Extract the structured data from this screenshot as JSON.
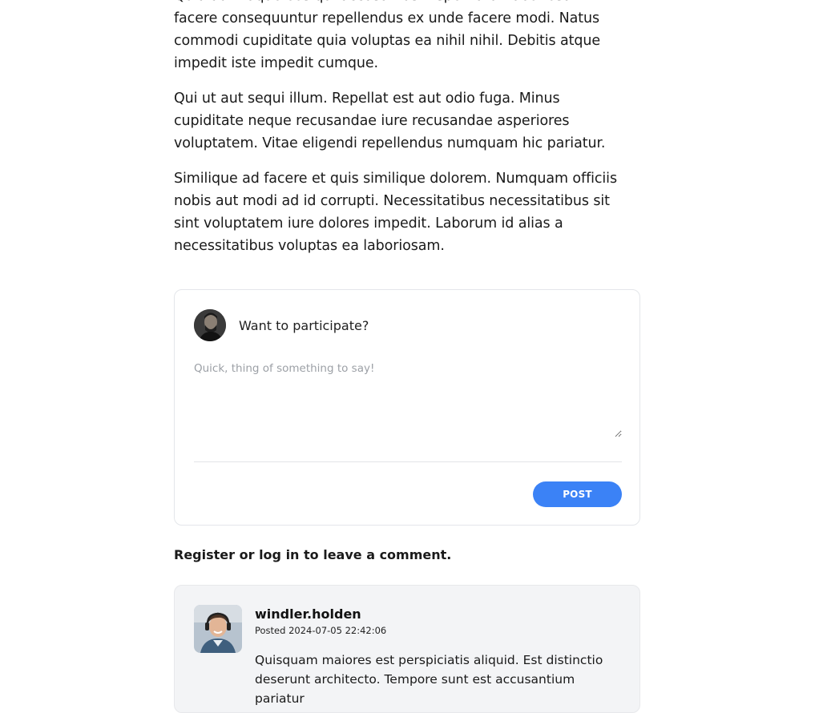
{
  "article": {
    "paragraphs": [
      "Quia aut itaque eos qui accusamus. Aspernatur laboriosam facere consequuntur repellendus ex unde facere modi. Natus commodi cupiditate quia voluptas ea nihil nihil. Debitis atque impedit iste impedit cumque.",
      "Qui ut aut sequi illum. Repellat est aut odio fuga. Minus cupiditate neque recusandae iure recusandae asperiores voluptatem. Vitae eligendi repellendus numquam hic pariatur.",
      "Similique ad facere et quis similique dolorem. Numquam officiis nobis aut modi ad id corrupti. Necessitatibus necessitatibus sit sint voluptatem iure dolores impedit. Laborum id alias a necessitatibus voluptas ea laboriosam."
    ]
  },
  "compose": {
    "title": "Want to participate?",
    "placeholder": "Quick, thing of something to say!",
    "post_label": "POST"
  },
  "auth_prompt": {
    "register": "Register",
    "or": " or ",
    "login": "log in",
    "suffix": " to leave a comment."
  },
  "comments": [
    {
      "author": "windler.holden",
      "posted": "Posted 2024-07-05 22:42:06",
      "body": "Quisquam maiores est perspiciatis aliquid. Est distinctio deserunt architecto. Tempore sunt est accusantium pariatur"
    }
  ],
  "colors": {
    "accent": "#3b82f6",
    "comment_bg": "#f3f4f6",
    "border": "#e4e6ea"
  },
  "icons": {
    "compose_avatar": "user-avatar-icon",
    "comment_avatar": "commenter-avatar-icon"
  }
}
